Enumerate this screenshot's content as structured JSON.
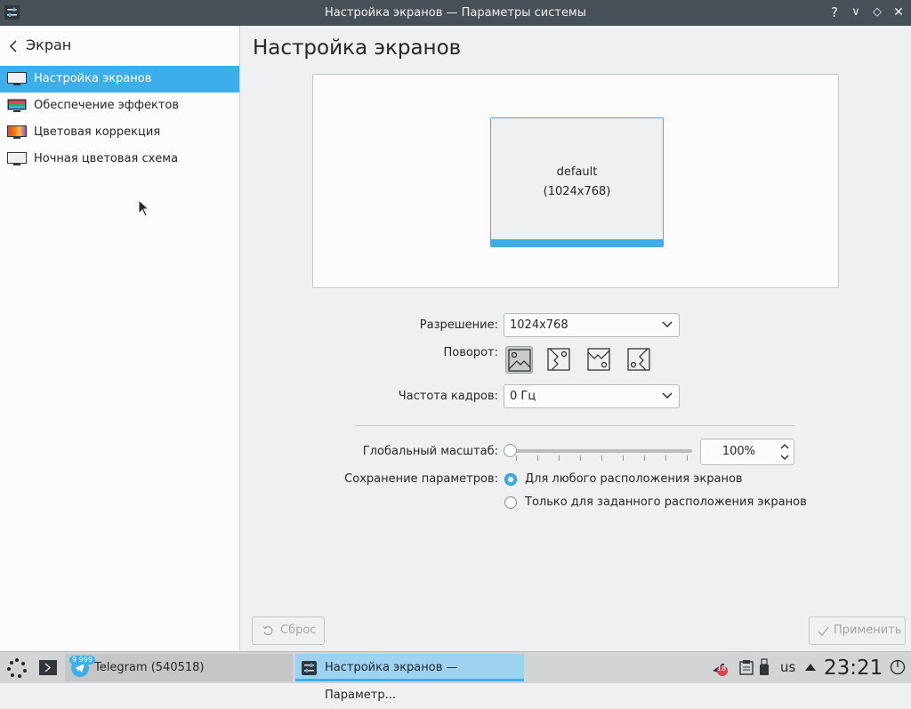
{
  "window": {
    "title": "Настройка экранов — Параметры системы",
    "help_glyph": "?",
    "minimize_glyph": "∨",
    "maximize_glyph": "◇",
    "close_glyph": "✕"
  },
  "sidebar": {
    "back_label": "Экран",
    "items": [
      {
        "label": "Настройка экранов",
        "icon": "monitor-icon",
        "active": true
      },
      {
        "label": "Обеспечение эффектов",
        "icon": "compositor-icon",
        "active": false
      },
      {
        "label": "Цветовая коррекция",
        "icon": "color-correction-icon",
        "active": false
      },
      {
        "label": "Ночная цветовая схема",
        "icon": "night-color-icon",
        "active": false
      }
    ]
  },
  "main": {
    "title": "Настройка экранов",
    "output": {
      "name": "default",
      "resolution": "(1024x768)"
    },
    "resolution_label": "Разрешение:",
    "resolution_value": "1024x768",
    "rotation_label": "Поворот:",
    "rotation_options": [
      "rotate-normal-icon",
      "rotate-left-icon",
      "rotate-inverted-icon",
      "rotate-right-icon"
    ],
    "rotation_selected": 0,
    "refresh_label": "Частота кадров:",
    "refresh_value": "0 Гц",
    "scale_label": "Глобальный масштаб:",
    "scale_value": "100%",
    "scale_fraction": 0,
    "save_label": "Сохранение параметров:",
    "save_options": [
      {
        "label": "Для любого расположения экранов",
        "checked": true
      },
      {
        "label": "Только для заданного расположения экранов",
        "checked": false
      }
    ],
    "reset_label": "Сброс",
    "apply_label": "Применить"
  },
  "taskbar": {
    "tasks": [
      {
        "label": "Telegram (540518)",
        "badge": "9 999",
        "active": false
      },
      {
        "label": "Настройка экранов  — Параметр...",
        "active": true
      }
    ],
    "tray": {
      "notification_count": "18",
      "keyboard_layout": "us",
      "clock": "23:21"
    }
  },
  "colors": {
    "accent": "#3daee9",
    "titlebar": "#475057",
    "sidebar_bg": "#fcfcfc",
    "window_bg": "#eff0f1"
  }
}
